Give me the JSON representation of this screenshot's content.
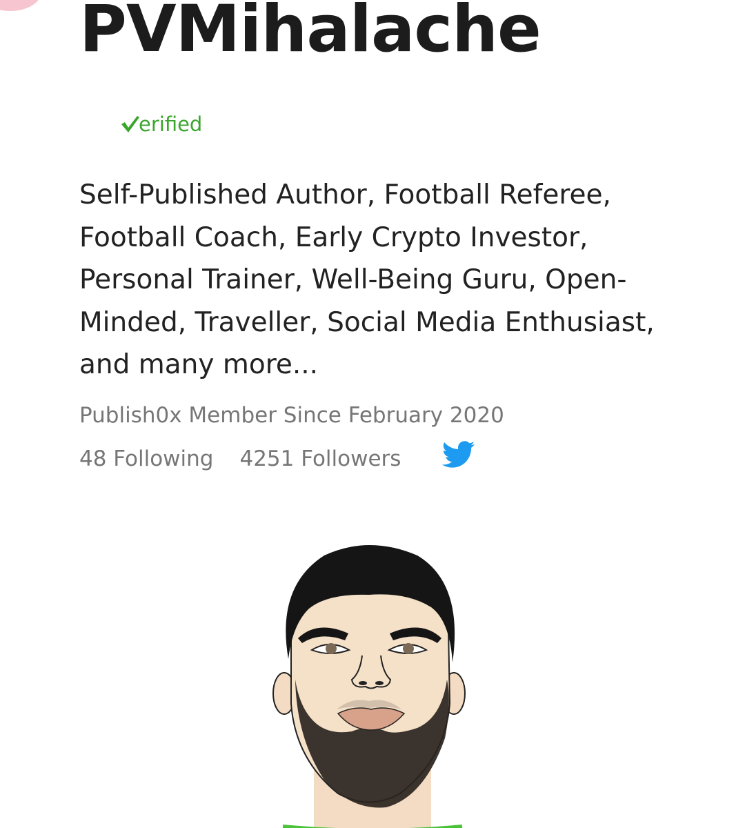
{
  "profile": {
    "username": "PVMihalache",
    "verified_label": "erified",
    "bio": "Self-Published Author, Football Referee, Football Coach, Early Crypto Investor, Personal Trainer, Well-Being Guru, Open-Minded, Traveller, Social Media Enthusiast, and many more...",
    "member_since": "Publish0x Member Since February 2020",
    "following": "48 Following",
    "followers": "4251 Followers"
  },
  "icons": {
    "verified": "check-icon",
    "social": "twitter-icon"
  },
  "colors": {
    "verified_green": "#3aa52c",
    "twitter_blue": "#1d9bf0",
    "muted_text": "#767676",
    "primary_text": "#222222"
  }
}
